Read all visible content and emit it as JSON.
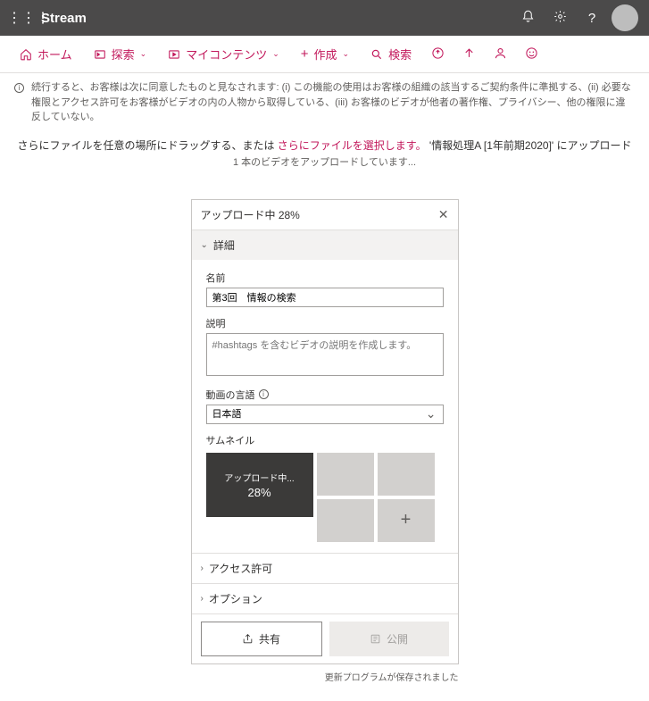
{
  "topbar": {
    "brand": "Stream"
  },
  "nav": {
    "home": "ホーム",
    "explore": "探索",
    "mycontent": "マイコンテンツ",
    "create": "作成",
    "search": "検索"
  },
  "notice": "続行すると、お客様は次に同意したものと見なされます: (i) この機能の使用はお客様の組織の該当するご契約条件に準拠する、(ii) 必要な権限とアクセス許可をお客様がビデオの内の人物から取得している、(iii) お客様のビデオが他者の著作権、プライバシー、他の権限に違反していない。",
  "banner": {
    "pre": "さらにファイルを任意の場所にドラッグする、または ",
    "link": "さらにファイルを選択します。",
    "post": " '情報処理A [1年前期2020]' にアップロード"
  },
  "subbanner": "1 本のビデオをアップロードしています...",
  "panel": {
    "title": "アップロード中 28%",
    "details": "詳細",
    "name_label": "名前",
    "name_value": "第3回　情報の検索",
    "desc_label": "説明",
    "desc_placeholder": "#hashtags を含むビデオの説明を作成します。",
    "lang_label": "動画の言語",
    "lang_value": "日本語",
    "thumb_label": "サムネイル",
    "uploading": "アップロード中...",
    "percent": "28%",
    "access": "アクセス許可",
    "options": "オプション",
    "share": "共有",
    "publish": "公開"
  },
  "saved": "更新プログラムが保存されました"
}
